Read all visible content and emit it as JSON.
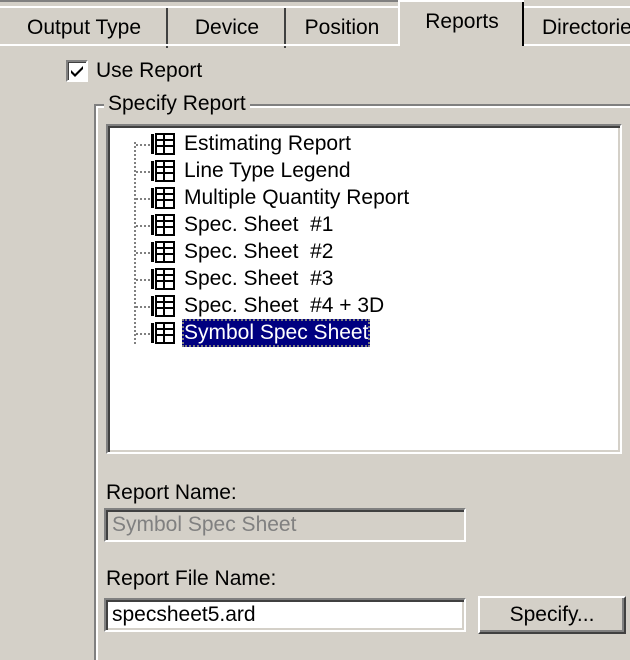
{
  "tabs": [
    {
      "label": "Output Type"
    },
    {
      "label": "Device"
    },
    {
      "label": "Position"
    },
    {
      "label": "Reports"
    },
    {
      "label": "Directories"
    }
  ],
  "active_tab": "Reports",
  "use_report": {
    "label": "Use Report",
    "checked": true
  },
  "specify_report": {
    "title": "Specify Report",
    "items": [
      {
        "label": "Estimating Report"
      },
      {
        "label": "Line Type Legend"
      },
      {
        "label": "Multiple Quantity Report"
      },
      {
        "label": "Spec. Sheet  #1"
      },
      {
        "label": "Spec. Sheet  #2"
      },
      {
        "label": "Spec. Sheet  #3"
      },
      {
        "label": "Spec. Sheet  #4 + 3D"
      },
      {
        "label": "Symbol Spec Sheet"
      }
    ],
    "selected_index": 7
  },
  "report_name": {
    "label": "Report Name:",
    "value": "Symbol Spec Sheet"
  },
  "report_file_name": {
    "label": "Report File Name:",
    "value": "specsheet5.ard"
  },
  "specify_button": {
    "label": "Specify..."
  },
  "icon": "report-document-icon"
}
